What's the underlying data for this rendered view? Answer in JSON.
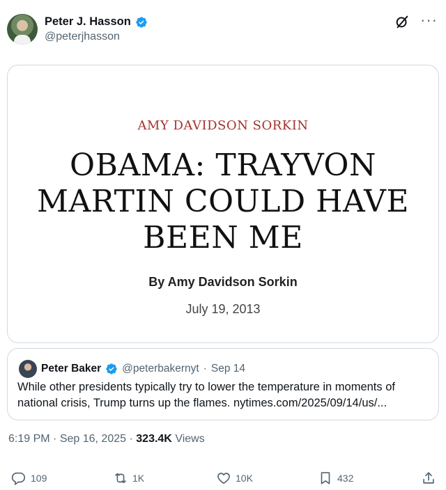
{
  "author": {
    "display_name": "Peter J. Hasson",
    "handle": "@peterjhasson",
    "verified": true
  },
  "header_icons": [
    "grok-icon",
    "more-icon"
  ],
  "more_label": "···",
  "article": {
    "kicker": "AMY DAVIDSON SORKIN",
    "title": "OBAMA: TRAYVON MARTIN COULD HAVE BEEN ME",
    "byline": "By Amy Davidson Sorkin",
    "date": "July 19, 2013"
  },
  "quoted_post": {
    "display_name": "Peter Baker",
    "handle": "@peterbakernyt",
    "separator": "·",
    "time": "Sep 14",
    "text": "While other presidents typically try to lower the temperature in moments of national crisis, Trump turns up the flames. nytimes.com/2025/09/14/us/..."
  },
  "meta": {
    "time": "6:19 PM",
    "date": "Sep 16, 2025",
    "views_count": "323.4K",
    "views_label": "Views"
  },
  "actions": {
    "replies": "109",
    "reposts": "1K",
    "likes": "10K",
    "bookmarks": "432"
  },
  "colors": {
    "verified_blue": "#1d9bf0",
    "kicker_red": "#a3322c",
    "muted": "#536471",
    "border": "#cfd9de"
  }
}
